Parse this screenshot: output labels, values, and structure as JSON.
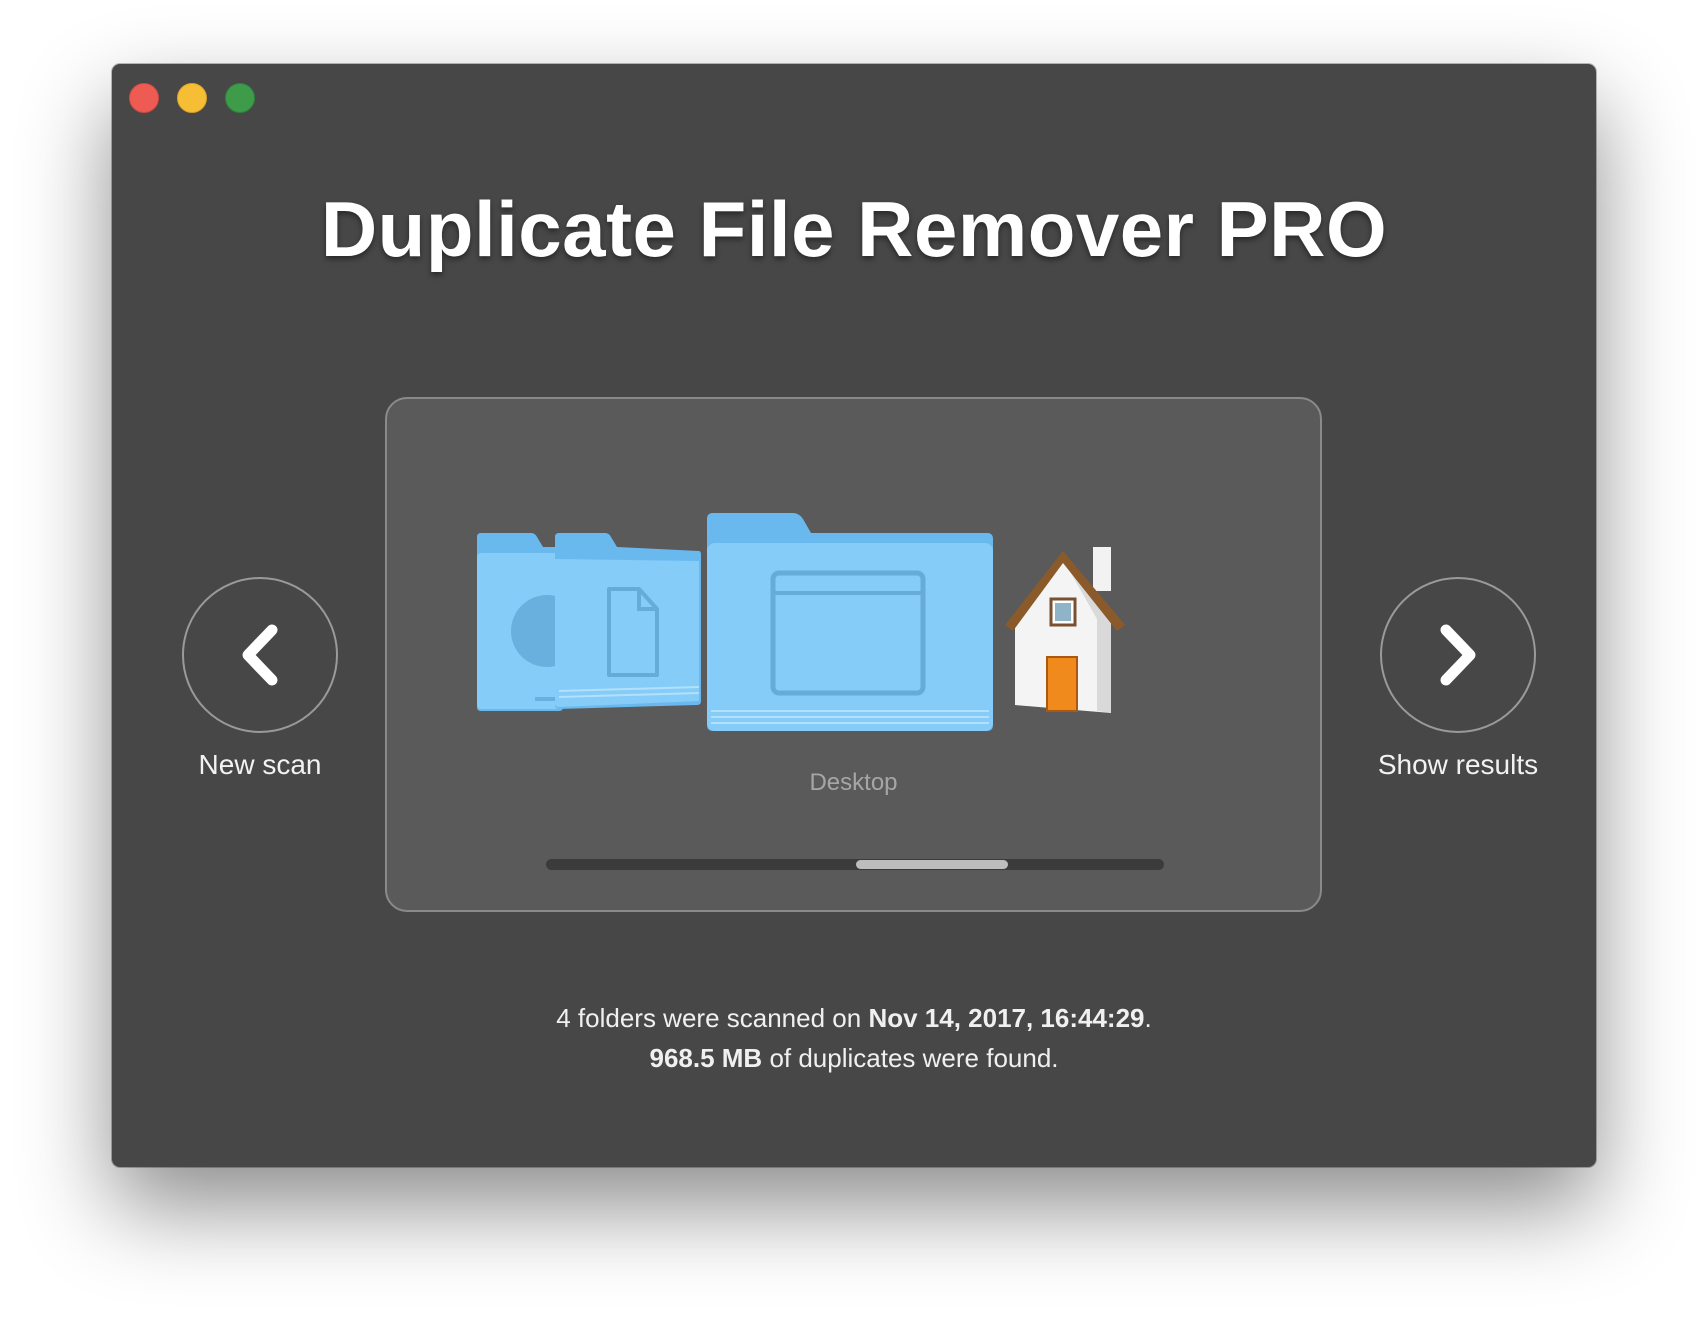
{
  "window": {
    "controls": [
      {
        "name": "close",
        "color": "#ff5f57"
      },
      {
        "name": "minimize",
        "color": "#febc2e"
      },
      {
        "name": "zoom",
        "color": "#28c840"
      }
    ]
  },
  "app": {
    "title": "Duplicate File Remover PRO"
  },
  "nav": {
    "prev_label": "New scan",
    "prev_icon": "chevron-left-icon",
    "next_label": "Show results",
    "next_icon": "chevron-right-icon"
  },
  "browser": {
    "items": [
      {
        "icon": "downloads-folder-icon"
      },
      {
        "icon": "documents-folder-icon"
      },
      {
        "icon": "desktop-folder-icon"
      },
      {
        "icon": "home-folder-icon"
      }
    ],
    "selected_label": "Desktop",
    "folder_color": "#7ec8f7"
  },
  "summary": {
    "line1_prefix": "4 folders were scanned on ",
    "line1_date": "Nov 14, 2017, 16:44:29",
    "line1_suffix": ".",
    "line2_size": "968.5 MB",
    "line2_suffix": " of duplicates were found."
  }
}
